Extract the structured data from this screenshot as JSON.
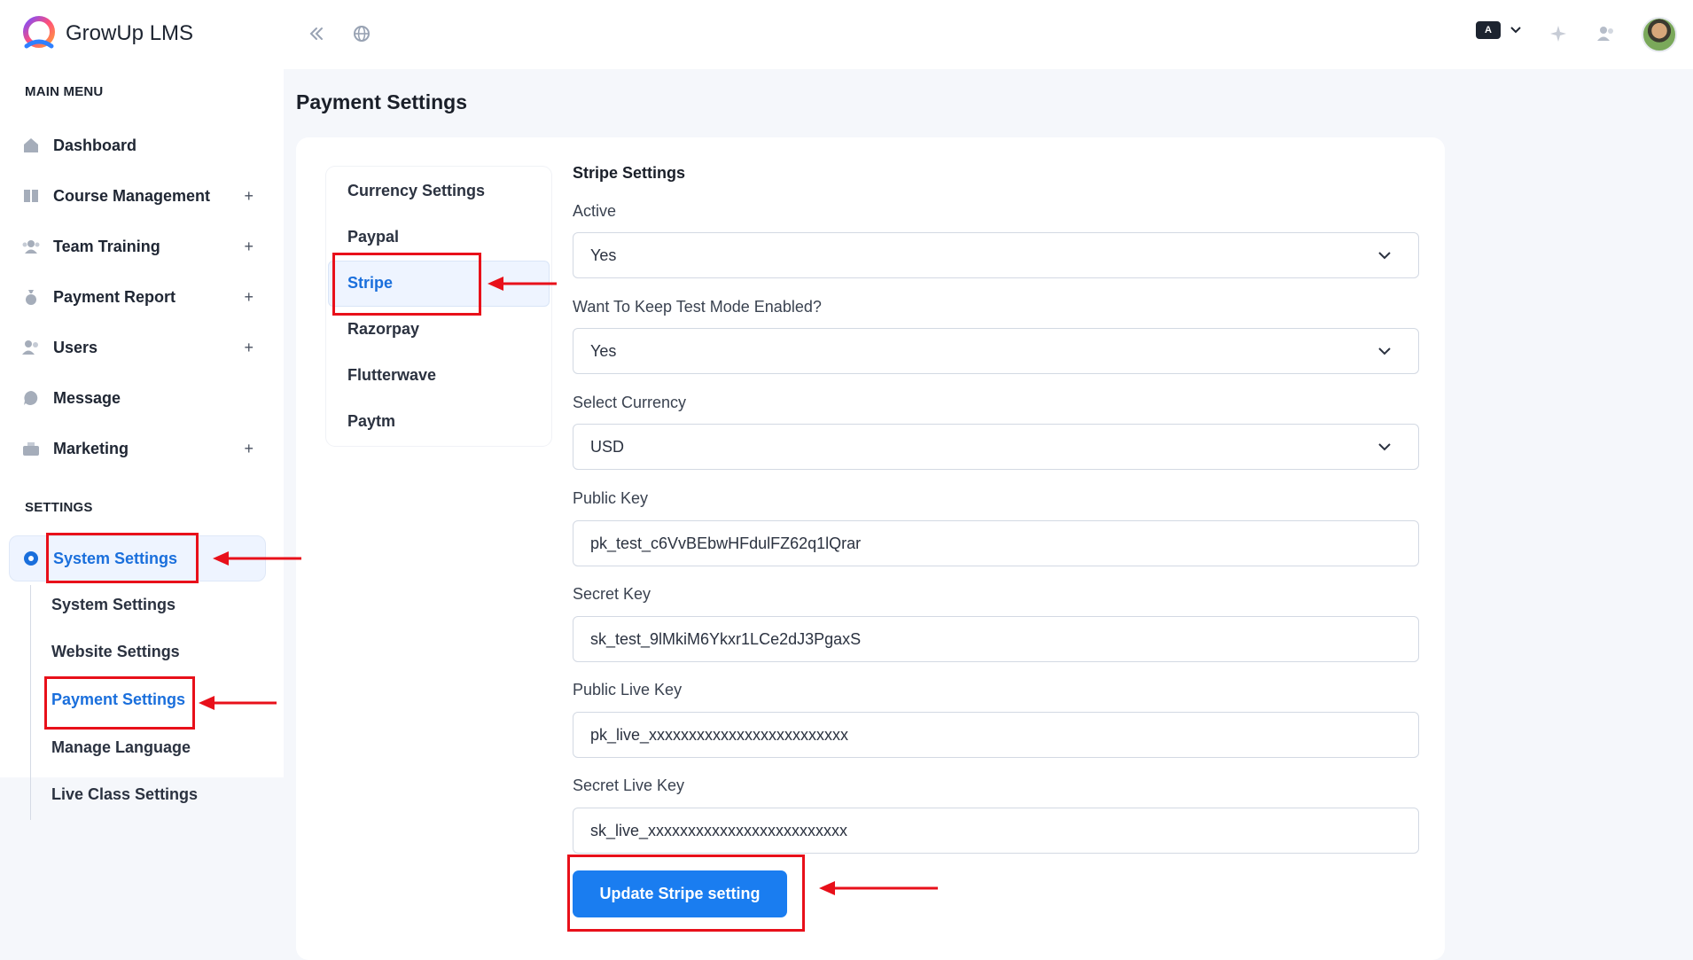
{
  "app": {
    "name": "GrowUp LMS"
  },
  "topbar": {
    "lang_badge": "A"
  },
  "sidebar": {
    "main_menu_label": "MAIN MENU",
    "items": [
      {
        "label": "Dashboard",
        "icon": "home-icon",
        "expandable": false
      },
      {
        "label": "Course Management",
        "icon": "book-icon",
        "expandable": true
      },
      {
        "label": "Team Training",
        "icon": "team-icon",
        "expandable": true
      },
      {
        "label": "Payment Report",
        "icon": "money-bag-icon",
        "expandable": true
      },
      {
        "label": "Users",
        "icon": "users-icon",
        "expandable": true
      },
      {
        "label": "Message",
        "icon": "chat-icon",
        "expandable": false
      },
      {
        "label": "Marketing",
        "icon": "marketing-icon",
        "expandable": true
      }
    ],
    "plus": "+",
    "settings_label": "SETTINGS",
    "settings_active": "System Settings",
    "sub_items": [
      "System Settings",
      "Website Settings",
      "Payment Settings",
      "Manage Language",
      "Live Class Settings"
    ]
  },
  "page": {
    "title": "Payment Settings"
  },
  "tabs": [
    "Currency Settings",
    "Paypal",
    "Stripe",
    "Razorpay",
    "Flutterwave",
    "Paytm"
  ],
  "form": {
    "title": "Stripe Settings",
    "active_label": "Active",
    "active_value": "Yes",
    "test_mode_label": "Want To Keep Test Mode Enabled?",
    "test_mode_value": "Yes",
    "currency_label": "Select Currency",
    "currency_value": "USD",
    "public_key_label": "Public Key",
    "public_key_value": "pk_test_c6VvBEbwHFdulFZ62q1lQrar",
    "secret_key_label": "Secret Key",
    "secret_key_value": "sk_test_9lMkiM6Ykxr1LCe2dJ3PgaxS",
    "public_live_key_label": "Public Live Key",
    "public_live_key_value": "pk_live_xxxxxxxxxxxxxxxxxxxxxxxxx",
    "secret_live_key_label": "Secret Live Key",
    "secret_live_key_value": "sk_live_xxxxxxxxxxxxxxxxxxxxxxxxx",
    "submit_label": "Update Stripe setting"
  },
  "colors": {
    "accent": "#1a7df0",
    "annotation": "#e8101a",
    "active_text": "#1a6fdc"
  }
}
